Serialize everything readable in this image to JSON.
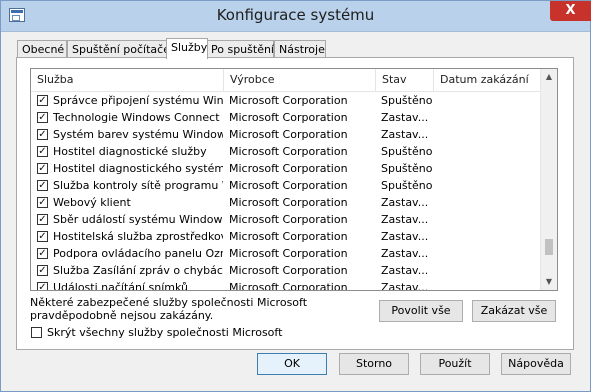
{
  "window": {
    "title": "Konfigurace systému",
    "close_glyph": "X"
  },
  "tabs": [
    {
      "label": "Obecné"
    },
    {
      "label": "Spuštění počítače"
    },
    {
      "label": "Služby"
    },
    {
      "label": "Po spuštění"
    },
    {
      "label": "Nástroje"
    }
  ],
  "active_tab": "Služby",
  "services": {
    "columns": [
      "Služba",
      "Výrobce",
      "Stav",
      "Datum zakázání"
    ],
    "rows": [
      {
        "checked": true,
        "name": "Správce připojení systému Wind...",
        "vendor": "Microsoft Corporation",
        "status": "Spuštěno"
      },
      {
        "checked": true,
        "name": "Technologie Windows Connect N...",
        "vendor": "Microsoft Corporation",
        "status": "Zastav..."
      },
      {
        "checked": true,
        "name": "Systém barev systému Windows",
        "vendor": "Microsoft Corporation",
        "status": "Zastav..."
      },
      {
        "checked": true,
        "name": "Hostitel diagnostické služby",
        "vendor": "Microsoft Corporation",
        "status": "Spuštěno"
      },
      {
        "checked": true,
        "name": "Hostitel diagnostického systému",
        "vendor": "Microsoft Corporation",
        "status": "Spuštěno"
      },
      {
        "checked": true,
        "name": "Služba kontroly sítě programu W...",
        "vendor": "Microsoft Corporation",
        "status": "Spuštěno"
      },
      {
        "checked": true,
        "name": "Webový klient",
        "vendor": "Microsoft Corporation",
        "status": "Zastav..."
      },
      {
        "checked": true,
        "name": "Sběr událostí systému Windows",
        "vendor": "Microsoft Corporation",
        "status": "Zastav..."
      },
      {
        "checked": true,
        "name": "Hostitelská služba zprostředkov...",
        "vendor": "Microsoft Corporation",
        "status": "Zastav..."
      },
      {
        "checked": true,
        "name": "Podpora ovládacího panelu Ozn...",
        "vendor": "Microsoft Corporation",
        "status": "Zastav..."
      },
      {
        "checked": true,
        "name": "Služba Zasílání zpráv o chybách ...",
        "vendor": "Microsoft Corporation",
        "status": "Zastav..."
      },
      {
        "checked": true,
        "name": "Události načítání snímků",
        "vendor": "Microsoft Corporation",
        "status": "Zastav..."
      }
    ],
    "scroll_up_glyph": "▲",
    "scroll_down_glyph": "▼"
  },
  "note": "Některé zabezpečené služby společnosti Microsoft pravděpodobně nejsou zakázány.",
  "buttons": {
    "enable_all": "Povolit vše",
    "disable_all": "Zakázat vše",
    "ok": "OK",
    "cancel": "Storno",
    "apply": "Použít",
    "help": "Nápověda"
  },
  "hide_ms_services": {
    "label": "Skrýt všechny služby společnosti Microsoft",
    "checked": false
  },
  "check_glyph": "✓",
  "icons": [
    "msconfig-app-icon",
    "close-icon",
    "checkbox-icon",
    "scroll-up-icon",
    "scroll-down-icon"
  ]
}
